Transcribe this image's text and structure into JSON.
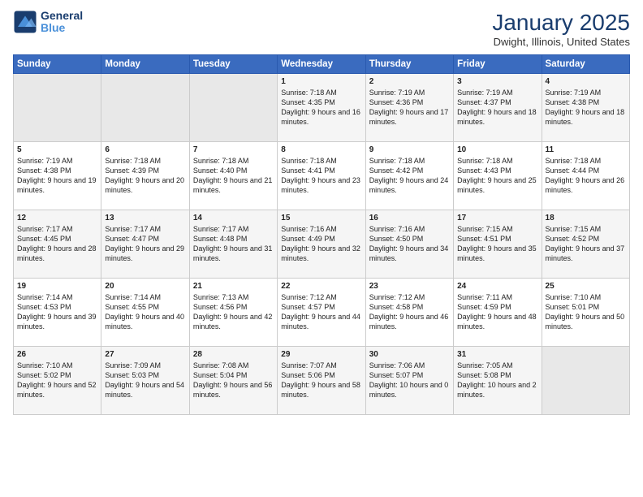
{
  "logo": {
    "line1": "General",
    "line2": "Blue"
  },
  "title": "January 2025",
  "subtitle": "Dwight, Illinois, United States",
  "days_of_week": [
    "Sunday",
    "Monday",
    "Tuesday",
    "Wednesday",
    "Thursday",
    "Friday",
    "Saturday"
  ],
  "weeks": [
    [
      {
        "day": "",
        "sunrise": "",
        "sunset": "",
        "daylight": "",
        "empty": true
      },
      {
        "day": "",
        "sunrise": "",
        "sunset": "",
        "daylight": "",
        "empty": true
      },
      {
        "day": "",
        "sunrise": "",
        "sunset": "",
        "daylight": "",
        "empty": true
      },
      {
        "day": "1",
        "sunrise": "Sunrise: 7:18 AM",
        "sunset": "Sunset: 4:35 PM",
        "daylight": "Daylight: 9 hours and 16 minutes."
      },
      {
        "day": "2",
        "sunrise": "Sunrise: 7:19 AM",
        "sunset": "Sunset: 4:36 PM",
        "daylight": "Daylight: 9 hours and 17 minutes."
      },
      {
        "day": "3",
        "sunrise": "Sunrise: 7:19 AM",
        "sunset": "Sunset: 4:37 PM",
        "daylight": "Daylight: 9 hours and 18 minutes."
      },
      {
        "day": "4",
        "sunrise": "Sunrise: 7:19 AM",
        "sunset": "Sunset: 4:38 PM",
        "daylight": "Daylight: 9 hours and 18 minutes."
      }
    ],
    [
      {
        "day": "5",
        "sunrise": "Sunrise: 7:19 AM",
        "sunset": "Sunset: 4:38 PM",
        "daylight": "Daylight: 9 hours and 19 minutes."
      },
      {
        "day": "6",
        "sunrise": "Sunrise: 7:18 AM",
        "sunset": "Sunset: 4:39 PM",
        "daylight": "Daylight: 9 hours and 20 minutes."
      },
      {
        "day": "7",
        "sunrise": "Sunrise: 7:18 AM",
        "sunset": "Sunset: 4:40 PM",
        "daylight": "Daylight: 9 hours and 21 minutes."
      },
      {
        "day": "8",
        "sunrise": "Sunrise: 7:18 AM",
        "sunset": "Sunset: 4:41 PM",
        "daylight": "Daylight: 9 hours and 23 minutes."
      },
      {
        "day": "9",
        "sunrise": "Sunrise: 7:18 AM",
        "sunset": "Sunset: 4:42 PM",
        "daylight": "Daylight: 9 hours and 24 minutes."
      },
      {
        "day": "10",
        "sunrise": "Sunrise: 7:18 AM",
        "sunset": "Sunset: 4:43 PM",
        "daylight": "Daylight: 9 hours and 25 minutes."
      },
      {
        "day": "11",
        "sunrise": "Sunrise: 7:18 AM",
        "sunset": "Sunset: 4:44 PM",
        "daylight": "Daylight: 9 hours and 26 minutes."
      }
    ],
    [
      {
        "day": "12",
        "sunrise": "Sunrise: 7:17 AM",
        "sunset": "Sunset: 4:45 PM",
        "daylight": "Daylight: 9 hours and 28 minutes."
      },
      {
        "day": "13",
        "sunrise": "Sunrise: 7:17 AM",
        "sunset": "Sunset: 4:47 PM",
        "daylight": "Daylight: 9 hours and 29 minutes."
      },
      {
        "day": "14",
        "sunrise": "Sunrise: 7:17 AM",
        "sunset": "Sunset: 4:48 PM",
        "daylight": "Daylight: 9 hours and 31 minutes."
      },
      {
        "day": "15",
        "sunrise": "Sunrise: 7:16 AM",
        "sunset": "Sunset: 4:49 PM",
        "daylight": "Daylight: 9 hours and 32 minutes."
      },
      {
        "day": "16",
        "sunrise": "Sunrise: 7:16 AM",
        "sunset": "Sunset: 4:50 PM",
        "daylight": "Daylight: 9 hours and 34 minutes."
      },
      {
        "day": "17",
        "sunrise": "Sunrise: 7:15 AM",
        "sunset": "Sunset: 4:51 PM",
        "daylight": "Daylight: 9 hours and 35 minutes."
      },
      {
        "day": "18",
        "sunrise": "Sunrise: 7:15 AM",
        "sunset": "Sunset: 4:52 PM",
        "daylight": "Daylight: 9 hours and 37 minutes."
      }
    ],
    [
      {
        "day": "19",
        "sunrise": "Sunrise: 7:14 AM",
        "sunset": "Sunset: 4:53 PM",
        "daylight": "Daylight: 9 hours and 39 minutes."
      },
      {
        "day": "20",
        "sunrise": "Sunrise: 7:14 AM",
        "sunset": "Sunset: 4:55 PM",
        "daylight": "Daylight: 9 hours and 40 minutes."
      },
      {
        "day": "21",
        "sunrise": "Sunrise: 7:13 AM",
        "sunset": "Sunset: 4:56 PM",
        "daylight": "Daylight: 9 hours and 42 minutes."
      },
      {
        "day": "22",
        "sunrise": "Sunrise: 7:12 AM",
        "sunset": "Sunset: 4:57 PM",
        "daylight": "Daylight: 9 hours and 44 minutes."
      },
      {
        "day": "23",
        "sunrise": "Sunrise: 7:12 AM",
        "sunset": "Sunset: 4:58 PM",
        "daylight": "Daylight: 9 hours and 46 minutes."
      },
      {
        "day": "24",
        "sunrise": "Sunrise: 7:11 AM",
        "sunset": "Sunset: 4:59 PM",
        "daylight": "Daylight: 9 hours and 48 minutes."
      },
      {
        "day": "25",
        "sunrise": "Sunrise: 7:10 AM",
        "sunset": "Sunset: 5:01 PM",
        "daylight": "Daylight: 9 hours and 50 minutes."
      }
    ],
    [
      {
        "day": "26",
        "sunrise": "Sunrise: 7:10 AM",
        "sunset": "Sunset: 5:02 PM",
        "daylight": "Daylight: 9 hours and 52 minutes."
      },
      {
        "day": "27",
        "sunrise": "Sunrise: 7:09 AM",
        "sunset": "Sunset: 5:03 PM",
        "daylight": "Daylight: 9 hours and 54 minutes."
      },
      {
        "day": "28",
        "sunrise": "Sunrise: 7:08 AM",
        "sunset": "Sunset: 5:04 PM",
        "daylight": "Daylight: 9 hours and 56 minutes."
      },
      {
        "day": "29",
        "sunrise": "Sunrise: 7:07 AM",
        "sunset": "Sunset: 5:06 PM",
        "daylight": "Daylight: 9 hours and 58 minutes."
      },
      {
        "day": "30",
        "sunrise": "Sunrise: 7:06 AM",
        "sunset": "Sunset: 5:07 PM",
        "daylight": "Daylight: 10 hours and 0 minutes."
      },
      {
        "day": "31",
        "sunrise": "Sunrise: 7:05 AM",
        "sunset": "Sunset: 5:08 PM",
        "daylight": "Daylight: 10 hours and 2 minutes."
      },
      {
        "day": "",
        "sunrise": "",
        "sunset": "",
        "daylight": "",
        "empty": true
      }
    ]
  ]
}
